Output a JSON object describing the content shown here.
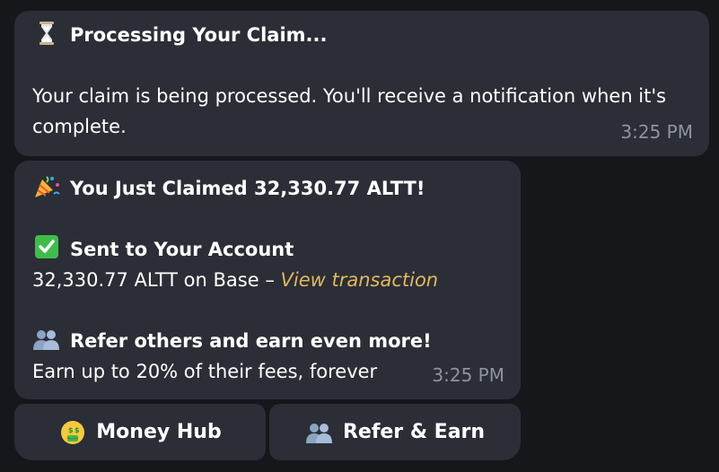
{
  "messages": [
    {
      "title_icon": "hourglass-icon",
      "title": "Processing Your Claim...",
      "body": "Your claim is being processed. You'll receive a notification when it's complete.",
      "time": "3:25 PM"
    },
    {
      "title_icon": "party-popper-icon",
      "title": "You Just Claimed 32,330.77 ALTT!",
      "sent_icon": "check-mark-icon",
      "sent_heading": "Sent to Your Account",
      "sent_detail": "32,330.77 ALTT on Base – ",
      "link_text": "View transaction",
      "refer_icon": "people-icon",
      "refer_heading": "Refer others and earn even more!",
      "refer_detail": "Earn up to 20% of their fees, forever",
      "time": "3:25 PM"
    }
  ],
  "buttons": {
    "money_hub": {
      "icon": "money-face-icon",
      "label": "Money Hub"
    },
    "refer_earn": {
      "icon": "people-icon",
      "label": "Refer & Earn"
    }
  },
  "colors": {
    "background": "#16171b",
    "bubble": "#2b2e36",
    "link": "#e2b760",
    "timestamp": "#8f949c"
  }
}
